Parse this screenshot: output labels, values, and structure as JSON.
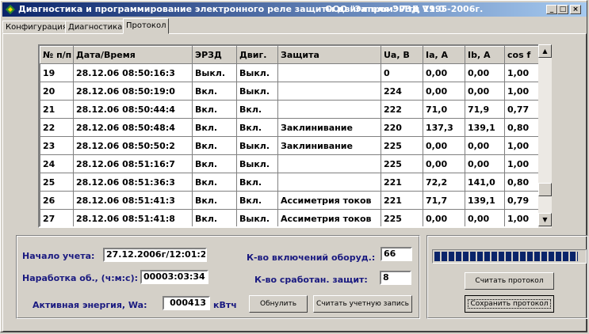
{
  "window": {
    "title": "Диагностика и программирование электронного реле защиты двигателя ЭРЗД   V1.0",
    "copyright": "ООО \"Элпром\" Лтд  1995-2006г."
  },
  "tabs": [
    {
      "label": "Конфигурация"
    },
    {
      "label": "Диагностика"
    },
    {
      "label": "Протокол"
    }
  ],
  "table": {
    "headers": [
      "№ п/п",
      "Дата/Время",
      "ЭРЗД",
      "Двиг.",
      "Защита",
      "Ua, В",
      "Ia, А",
      "Ib, А",
      "cos f"
    ],
    "rows": [
      [
        "19",
        "28.12.06  08:50:16:3",
        "Выкл.",
        "Выкл.",
        "",
        "0",
        "0,00",
        "0,00",
        "1,00"
      ],
      [
        "20",
        "28.12.06  08:50:19:0",
        "Вкл.",
        "Выкл.",
        "",
        "224",
        "0,00",
        "0,00",
        "1,00"
      ],
      [
        "21",
        "28.12.06  08:50:44:4",
        "Вкл.",
        "Вкл.",
        "",
        "222",
        "71,0",
        "71,9",
        "0,77"
      ],
      [
        "22",
        "28.12.06  08:50:48:4",
        "Вкл.",
        "Вкл.",
        "Заклинивание",
        "220",
        "137,3",
        "139,1",
        "0,80"
      ],
      [
        "23",
        "28.12.06  08:50:50:2",
        "Вкл.",
        "Выкл.",
        "Заклинивание",
        "225",
        "0,00",
        "0,00",
        "1,00"
      ],
      [
        "24",
        "28.12.06  08:51:16:7",
        "Вкл.",
        "Выкл.",
        "",
        "225",
        "0,00",
        "0,00",
        "1,00"
      ],
      [
        "25",
        "28.12.06  08:51:36:3",
        "Вкл.",
        "Вкл.",
        "",
        "221",
        "72,2",
        "141,0",
        "0,80"
      ],
      [
        "26",
        "28.12.06  08:51:41:3",
        "Вкл.",
        "Вкл.",
        "Ассиметрия токов",
        "221",
        "71,7",
        "139,1",
        "0,79"
      ],
      [
        "27",
        "28.12.06  08:51:41:8",
        "Вкл.",
        "Выкл.",
        "Ассиметрия токов",
        "225",
        "0,00",
        "0,00",
        "1,00"
      ]
    ]
  },
  "stats": {
    "start_label": "Начало учета:",
    "start_value": "27.12.2006г/12:01:24",
    "runtime_label": "Наработка об., (ч:м:с):",
    "runtime_value": "00003:03:34",
    "energy_label": "Активная энергия, Wa:",
    "energy_value": "000413",
    "energy_unit": "кВтч",
    "switch_on_label": "К-во включений оборуд.:",
    "switch_on_value": "66",
    "trips_label": "К-во сработан. защит:",
    "trips_value": "8"
  },
  "buttons": {
    "reset": "Обнулить",
    "read_record": "Считать учетную запись",
    "read_protocol": "Считать протокол",
    "save_protocol": "Сохранить протокол"
  },
  "progress": {
    "fraction": 0.96
  },
  "colors": {
    "title_start": "#0a246a",
    "title_end": "#a6caf0",
    "label_text": "#1a1a80",
    "progress_fill": "#0a246a"
  }
}
